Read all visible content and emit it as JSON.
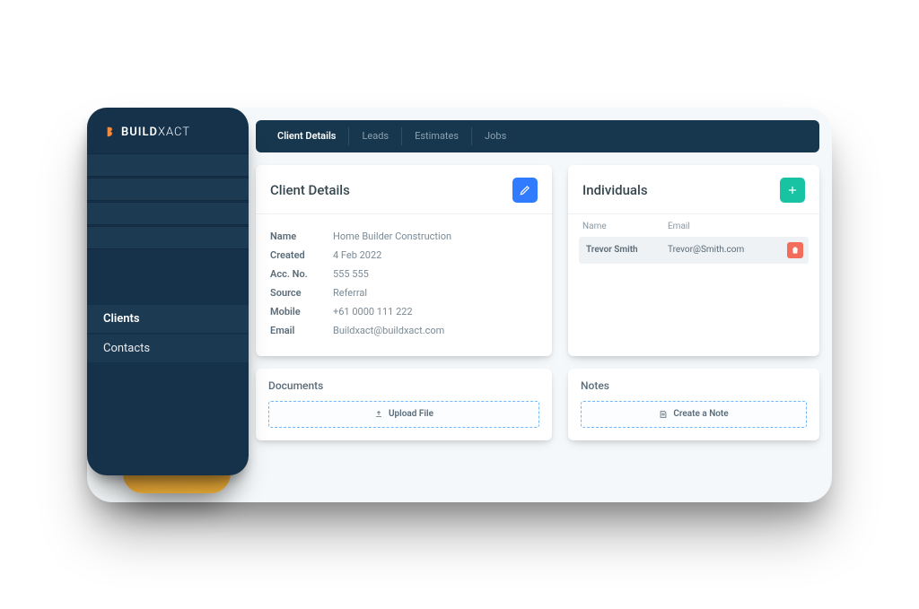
{
  "brand": {
    "name_bold": "BUILD",
    "name_thin": "XACT"
  },
  "sidebar": {
    "items": [
      {
        "label": "Clients"
      },
      {
        "label": "Contacts"
      }
    ]
  },
  "tabs": [
    {
      "label": "Client Details"
    },
    {
      "label": "Leads"
    },
    {
      "label": "Estimates"
    },
    {
      "label": "Jobs"
    }
  ],
  "client_details": {
    "title": "Client Details",
    "rows": [
      {
        "label": "Name",
        "value": "Home Builder Construction"
      },
      {
        "label": "Created",
        "value": "4 Feb 2022"
      },
      {
        "label": "Acc. No.",
        "value": "555 555"
      },
      {
        "label": "Source",
        "value": "Referral"
      },
      {
        "label": "Mobile",
        "value": "+61 0000 111 222"
      },
      {
        "label": "Email",
        "value": "Buildxact@buildxact.com"
      }
    ]
  },
  "individuals": {
    "title": "Individuals",
    "columns": {
      "name": "Name",
      "email": "Email"
    },
    "rows": [
      {
        "name": "Trevor Smith",
        "email": "Trevor@Smith.com"
      }
    ]
  },
  "documents": {
    "title": "Documents",
    "button": "Upload File"
  },
  "notes": {
    "title": "Notes",
    "button": "Create a Note"
  }
}
